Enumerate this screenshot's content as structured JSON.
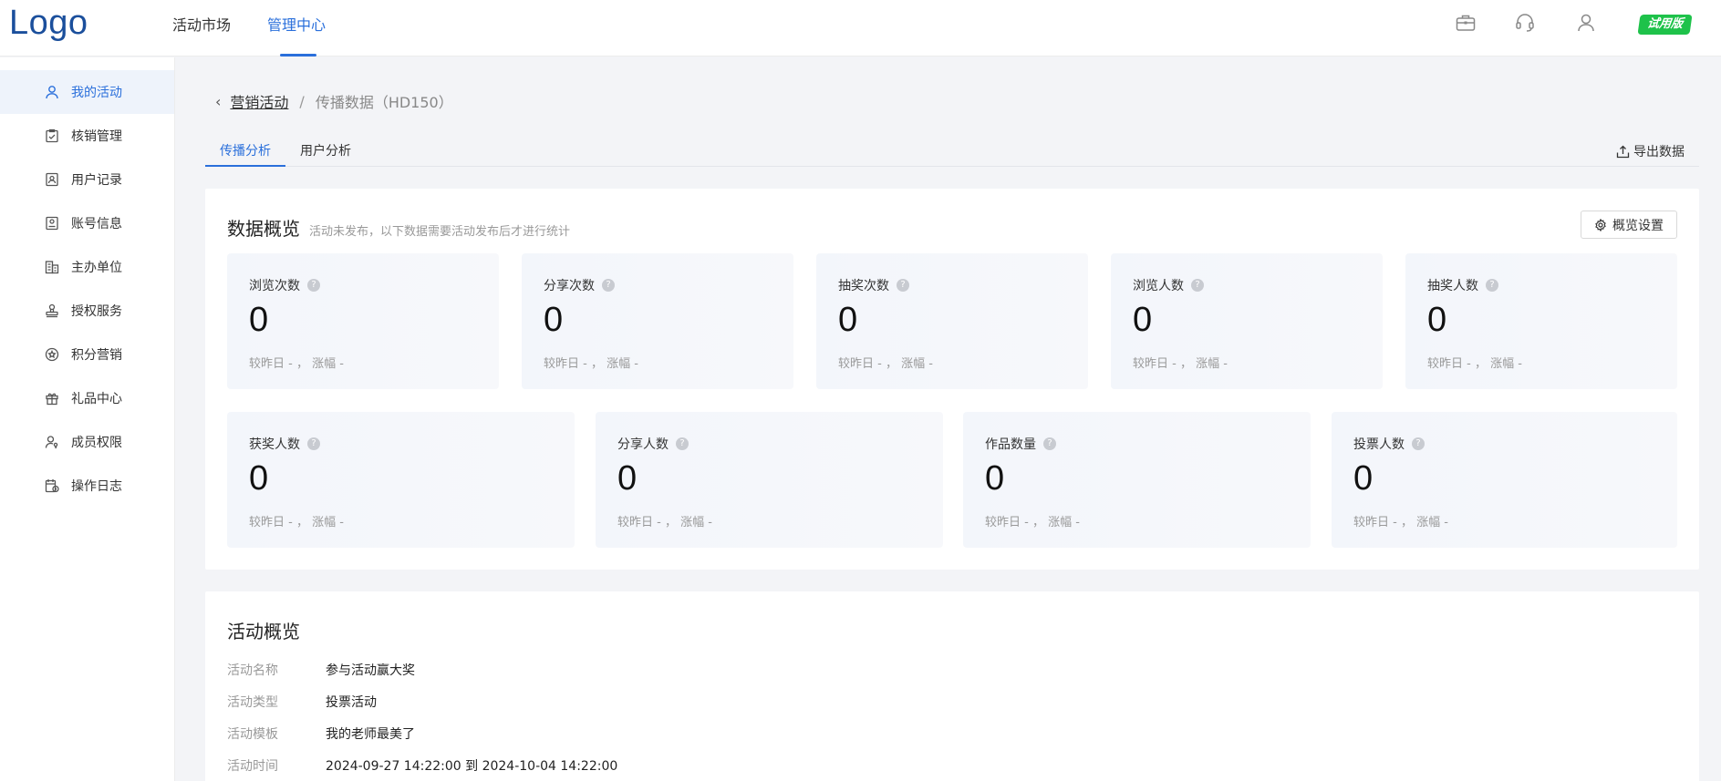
{
  "header": {
    "logo": "Logo",
    "nav": [
      {
        "label": "活动市场",
        "active": false
      },
      {
        "label": "管理中心",
        "active": true
      }
    ],
    "icons": [
      "briefcase-icon",
      "headset-icon",
      "user-icon"
    ],
    "trial_badge": "试用版"
  },
  "sidebar": {
    "items": [
      {
        "label": "我的活动",
        "icon": "user-icon",
        "active": true
      },
      {
        "label": "核销管理",
        "icon": "clipboard-check-icon",
        "active": false
      },
      {
        "label": "用户记录",
        "icon": "user-card-icon",
        "active": false
      },
      {
        "label": "账号信息",
        "icon": "id-card-icon",
        "active": false
      },
      {
        "label": "主办单位",
        "icon": "building-icon",
        "active": false
      },
      {
        "label": "授权服务",
        "icon": "stamp-icon",
        "active": false
      },
      {
        "label": "积分营销",
        "icon": "star-circle-icon",
        "active": false
      },
      {
        "label": "礼品中心",
        "icon": "gift-icon",
        "active": false
      },
      {
        "label": "成员权限",
        "icon": "user-key-icon",
        "active": false
      },
      {
        "label": "操作日志",
        "icon": "log-calendar-icon",
        "active": false
      }
    ]
  },
  "breadcrumb": {
    "back": "‹",
    "parent": "营销活动",
    "separator": "/",
    "current": "传播数据（HD150）"
  },
  "tabs": [
    {
      "label": "传播分析",
      "active": true
    },
    {
      "label": "用户分析",
      "active": false
    }
  ],
  "export_label": "导出数据",
  "overview": {
    "title": "数据概览",
    "subtitle": "活动未发布，以下数据需要活动发布后才进行统计",
    "settings_label": "概览设置",
    "help_glyph": "?",
    "row1": [
      {
        "label": "浏览次数",
        "value": "0",
        "trend": "较昨日 - ， 涨幅 -"
      },
      {
        "label": "分享次数",
        "value": "0",
        "trend": "较昨日 - ， 涨幅 -"
      },
      {
        "label": "抽奖次数",
        "value": "0",
        "trend": "较昨日 - ， 涨幅 -"
      },
      {
        "label": "浏览人数",
        "value": "0",
        "trend": "较昨日 - ， 涨幅 -"
      },
      {
        "label": "抽奖人数",
        "value": "0",
        "trend": "较昨日 - ， 涨幅 -"
      }
    ],
    "row2": [
      {
        "label": "获奖人数",
        "value": "0",
        "trend": "较昨日 - ， 涨幅 -"
      },
      {
        "label": "分享人数",
        "value": "0",
        "trend": "较昨日 - ， 涨幅 -"
      },
      {
        "label": "作品数量",
        "value": "0",
        "trend": "较昨日 - ， 涨幅 -"
      },
      {
        "label": "投票人数",
        "value": "0",
        "trend": "较昨日 - ， 涨幅 -"
      }
    ]
  },
  "activity": {
    "title": "活动概览",
    "rows": [
      {
        "key": "活动名称",
        "value": "参与活动赢大奖"
      },
      {
        "key": "活动类型",
        "value": "投票活动"
      },
      {
        "key": "活动模板",
        "value": "我的老师最美了"
      },
      {
        "key": "活动时间",
        "value": "2024-09-27 14:22:00 到 2024-10-04 14:22:00"
      }
    ]
  },
  "colors": {
    "accent": "#2a6fdb",
    "trial": "#1ec24a",
    "logo": "#1b4f9c"
  }
}
